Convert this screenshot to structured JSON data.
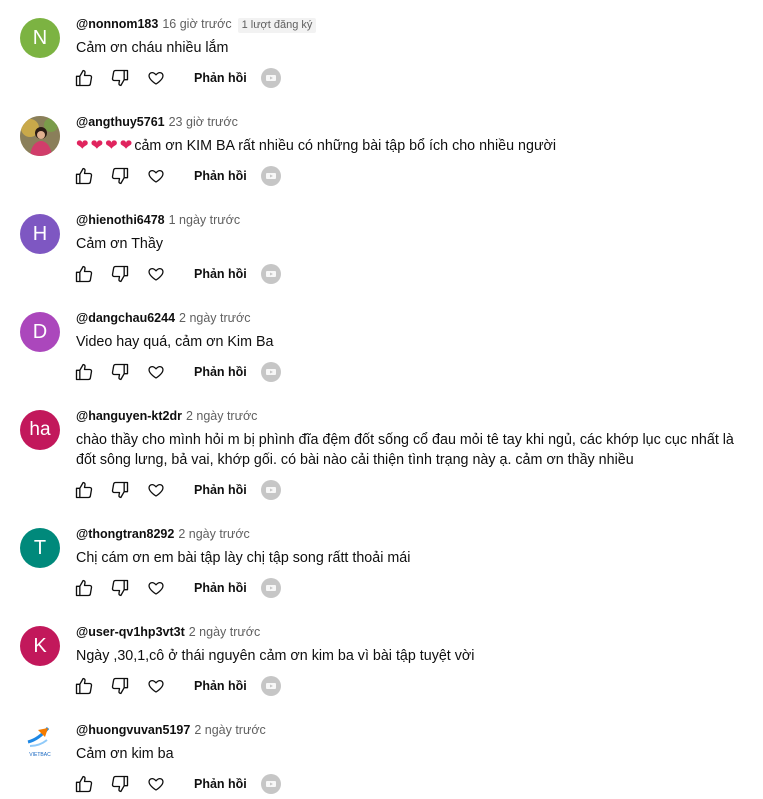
{
  "comments": [
    {
      "author": "@nonnom183",
      "time": "16 giờ trước",
      "badge": "1 lượt đăng ký",
      "text": "Cảm ơn cháu nhiều lắm",
      "avatar": {
        "letter": "N",
        "color": "#7cb342"
      }
    },
    {
      "author": "@angthuy5761",
      "time": "23 giờ trước",
      "hearts": [
        "❤",
        "❤",
        "❤",
        "❤"
      ],
      "text": "cảm ơn KIM BA rất nhiều có những bài tập bổ ích cho nhiều người",
      "avatar": {
        "photo": true
      }
    },
    {
      "author": "@hienothi6478",
      "time": "1 ngày trước",
      "text": "Cảm ơn Thầy",
      "avatar": {
        "letter": "H",
        "color": "#7e57c2"
      }
    },
    {
      "author": "@dangchau6244",
      "time": "2 ngày trước",
      "text": "Video hay quá, cảm ơn Kim Ba",
      "avatar": {
        "letter": "D",
        "color": "#ab47bc"
      }
    },
    {
      "author": "@hanguyen-kt2dr",
      "time": "2 ngày trước",
      "text": "chào thầy cho mình hỏi m bị phình đĩa đệm đốt sống cổ đau mỏi tê tay khi ngủ, các khớp lục cục nhất là đốt sông lưng, bả vai, khớp gối. có bài nào cải thiện tình trạng này ạ. cảm ơn thầy nhiều",
      "avatar": {
        "letter": "ha",
        "color": "#c2185b"
      }
    },
    {
      "author": "@thongtran8292",
      "time": "2 ngày trước",
      "text": "Chị cám ơn em bài tập lày chị tập song rấtt thoải mái",
      "avatar": {
        "letter": "T",
        "color": "#00897b"
      }
    },
    {
      "author": "@user-qv1hp3vt3t",
      "time": "2 ngày trước",
      "text": "Ngày ,30,1,cô ở thái nguyên cảm ơn kim ba vì bài tập tuyệt vời",
      "avatar": {
        "letter": "K",
        "color": "#c2185b"
      }
    },
    {
      "author": "@huongvuvan5197",
      "time": "2 ngày trước",
      "text": "Cảm ơn kim ba",
      "avatar": {
        "logo": true,
        "logo_text": "VIETBAC"
      }
    }
  ],
  "labels": {
    "reply": "Phản hồi"
  },
  "icons": {
    "like": "thumb-up-icon",
    "dislike": "thumb-down-icon",
    "heart": "heart-icon",
    "creator_heart": "creator-avatar-icon"
  }
}
